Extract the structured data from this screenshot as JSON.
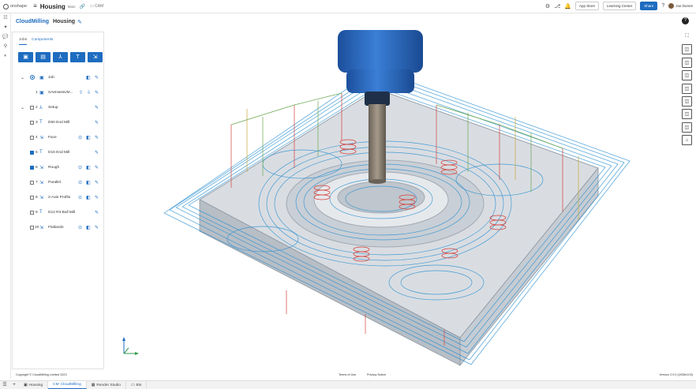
{
  "topbar": {
    "brand": "onshape",
    "doc_title": "Housing",
    "branch": "Main",
    "folder": "CAM",
    "app_store": "App Store",
    "learning_center": "Learning Center",
    "share": "Share",
    "user": "Joe Dunne"
  },
  "appbar": {
    "app_name": "CloudMilling",
    "doc_name": "Housing"
  },
  "panel": {
    "tabs": [
      "Jobs",
      "Components"
    ],
    "rows": [
      {
        "num": "",
        "label": "Job"
      },
      {
        "num": "1",
        "label": "SAeHassUM..."
      },
      {
        "num": "2",
        "label": "Setup"
      },
      {
        "num": "3",
        "label": "D50 End Mill"
      },
      {
        "num": "4",
        "label": "Face"
      },
      {
        "num": "5",
        "label": "D15 End Mill"
      },
      {
        "num": "6",
        "label": "Rough"
      },
      {
        "num": "7",
        "label": "Parallel"
      },
      {
        "num": "8",
        "label": "2-Axis Profile"
      },
      {
        "num": "9",
        "label": "D12 R3 Bull Mill"
      },
      {
        "num": "10",
        "label": "Flatlands"
      }
    ]
  },
  "footer": {
    "copyright": "Copyright © CloudMilling Limited 2023",
    "terms": "Terms of Use",
    "privacy": "Privacy Notice",
    "version": "Version 2.9.0 (2035e103)"
  },
  "bottom_tabs": [
    {
      "label": "Housing"
    },
    {
      "label": "CloudMilling"
    },
    {
      "label": "Render Studio"
    },
    {
      "label": "Bin"
    }
  ],
  "colors": {
    "accent": "#1e6cc0",
    "toolpath_blue": "#2a8fd0",
    "toolpath_red": "#d6423c",
    "toolpath_green": "#6aa84f",
    "toolpath_yellow": "#c9a93a"
  }
}
